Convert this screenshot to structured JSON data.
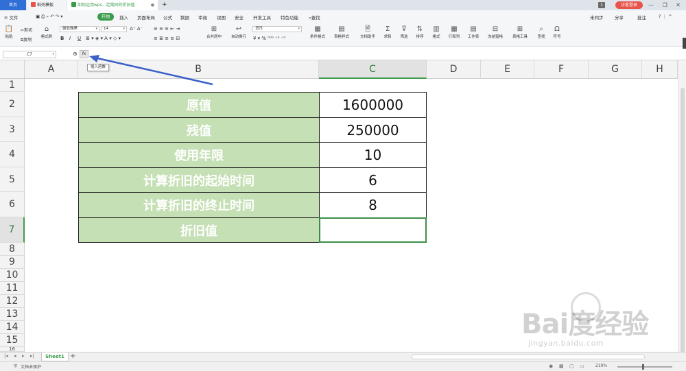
{
  "titlebar": {
    "tabs": [
      {
        "label": "首页"
      },
      {
        "label": "稻壳模板"
      },
      {
        "label": "如何运用wps...定期间的折旧值"
      }
    ],
    "login": "访客登录",
    "badge": "1"
  },
  "menu": {
    "file": "≡ 文件",
    "items": [
      "开始",
      "插入",
      "页面布局",
      "公式",
      "数据",
      "审阅",
      "视图",
      "安全",
      "开发工具",
      "特色功能"
    ],
    "search": "查找",
    "right": [
      "未同步",
      "分享",
      "批注"
    ]
  },
  "ribbon": {
    "paste": "粘贴",
    "cut": "剪切",
    "copy": "复制",
    "format_painter": "格式刷",
    "font_name": "微软雅黑",
    "font_size": "14",
    "merge": "合并居中",
    "wrap": "自动换行",
    "number_format": "货币",
    "cond_format": "条件格式",
    "table_style": "表格样式",
    "doc_helper": "文档助手",
    "sum": "求和",
    "filter": "筛选",
    "sort": "排序",
    "format": "格式",
    "row_col": "行和列",
    "worksheet": "工作表",
    "freeze": "冻结窗格",
    "table_tools": "表格工具",
    "find": "查找",
    "symbol": "符号"
  },
  "formula_bar": {
    "cell_ref": "C7",
    "fx_label": "fx",
    "tooltip": "插入函数"
  },
  "columns": [
    "A",
    "B",
    "C",
    "D",
    "E",
    "F",
    "G",
    "H"
  ],
  "rows": [
    "1",
    "2",
    "3",
    "4",
    "5",
    "6",
    "7",
    "8",
    "9",
    "10",
    "11",
    "12",
    "13",
    "14",
    "15",
    "16"
  ],
  "table": {
    "labels": [
      "原值",
      "残值",
      "使用年限",
      "计算折旧的起始时间",
      "计算折旧的终止时间",
      "折旧值"
    ],
    "values": [
      "1600000",
      "250000",
      "10",
      "6",
      "8",
      ""
    ]
  },
  "sheet": {
    "tab": "Sheet1",
    "add": "+"
  },
  "status": {
    "protect": "文档未保护",
    "zoom": "210%"
  },
  "watermark": {
    "main": "Bai度经验",
    "sub": "jingyan.baidu.com"
  },
  "colors": {
    "accent": "#3c9b4b",
    "label_fill": "#c5e0b4",
    "arrow": "#3a5fc8"
  }
}
